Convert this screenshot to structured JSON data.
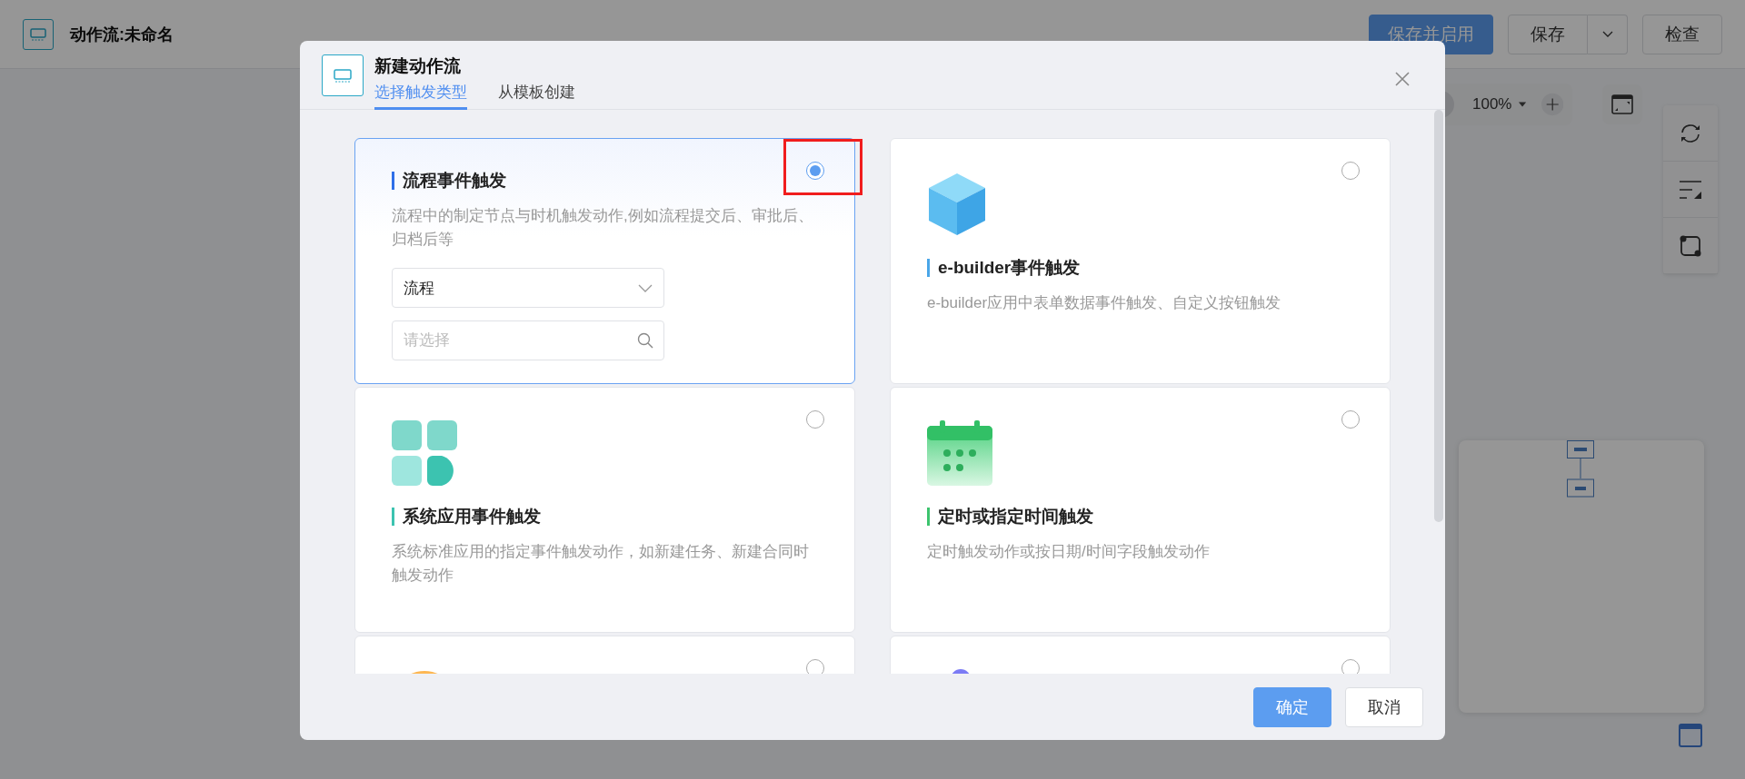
{
  "page": {
    "title": "动作流:未命名"
  },
  "toolbar": {
    "buttons": [
      {
        "label": "保存并启用",
        "kind": "primary"
      },
      {
        "label": "保存",
        "kind": "split"
      },
      {
        "label": "检查",
        "kind": "default"
      }
    ]
  },
  "zoom": {
    "value": "100%"
  },
  "dialog": {
    "title": "新建动作流",
    "tabs": [
      {
        "label": "选择触发类型",
        "selected": true
      },
      {
        "label": "从模板创建",
        "selected": false
      }
    ],
    "cards": [
      {
        "kind": "process",
        "title": "流程事件触发",
        "description": "流程中的制定节点与时机触发动作,例如流程提交后、审批后、归档后等",
        "color": "#2f6fe8",
        "selected": true,
        "select": {
          "value": "流程"
        },
        "search": {
          "placeholder": "请选择"
        }
      },
      {
        "kind": "builder",
        "title": "e-builder事件触发",
        "description": "e-builder应用中表单数据事件触发、自定义按钮触发",
        "color": "#4aa6e8",
        "selected": false
      },
      {
        "kind": "system",
        "title": "系统应用事件触发",
        "description": "系统标准应用的指定事件触发动作，如新建任务、新建合同时触发动作",
        "color": "#3cc3b0",
        "selected": false
      },
      {
        "kind": "timer",
        "title": "定时或指定时间触发",
        "description": "定时触发动作或按日期/时间字段触发动作",
        "color": "#3dc46e",
        "selected": false
      },
      {
        "kind": "circle",
        "selected": false
      },
      {
        "kind": "dot",
        "selected": false
      }
    ],
    "buttons": [
      {
        "label": "确定",
        "kind": "primary"
      },
      {
        "label": "取消",
        "kind": "default"
      }
    ]
  }
}
